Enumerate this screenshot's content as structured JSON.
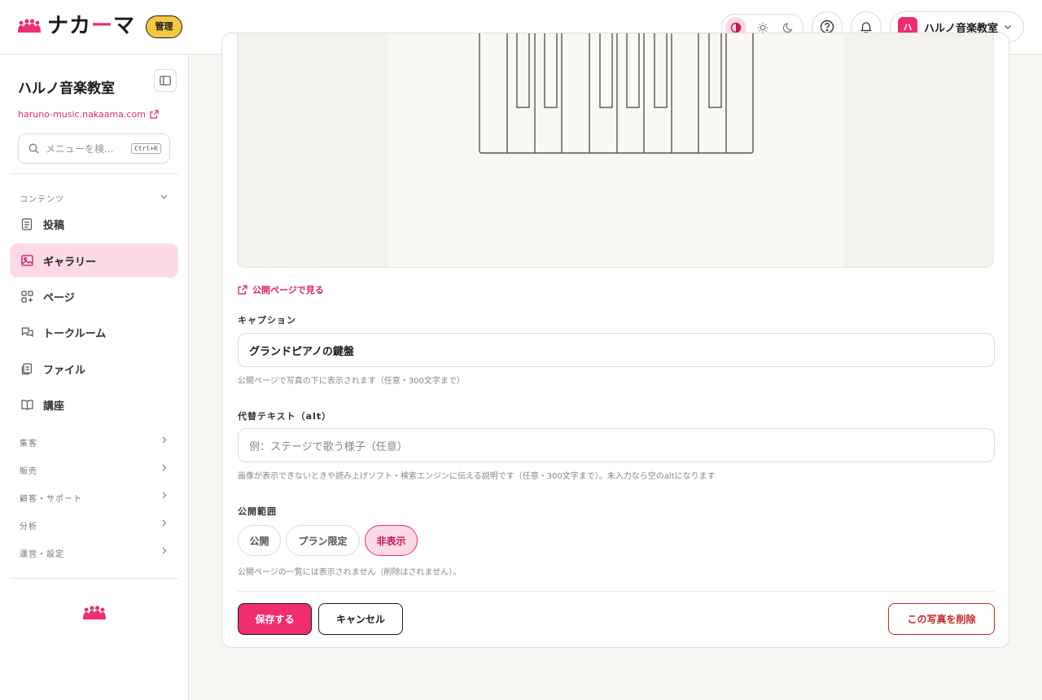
{
  "header": {
    "logo_text_1": "ナカ",
    "logo_text_accent": "ー",
    "logo_text_2": "マ",
    "admin_badge": "管理",
    "account_avatar": "ハ",
    "account_name": "ハルノ音楽教室"
  },
  "sidebar": {
    "site_name": "ハルノ音楽教室",
    "site_url": "haruno-music.nakaama.com",
    "search_placeholder": "メニューを検...",
    "search_shortcut": "Ctrl+K",
    "content_section": "コンテンツ",
    "items": [
      {
        "label": "投稿",
        "icon": "document-icon"
      },
      {
        "label": "ギャラリー",
        "icon": "image-icon",
        "active": true
      },
      {
        "label": "ページ",
        "icon": "grid-plus-icon"
      },
      {
        "label": "トークルーム",
        "icon": "chat-icon"
      },
      {
        "label": "ファイル",
        "icon": "files-icon"
      },
      {
        "label": "講座",
        "icon": "book-icon"
      }
    ],
    "sections": [
      "集客",
      "販売",
      "顧客・サポート",
      "分析",
      "運営・設定"
    ]
  },
  "main": {
    "view_public_link": "公開ページで見る",
    "caption_label": "キャプション",
    "caption_value": "グランドピアノの鍵盤",
    "caption_help": "公開ページで写真の下に表示されます（任意・300文字まで）",
    "alt_label": "代替テキスト（alt）",
    "alt_placeholder": "例：ステージで歌う様子（任意）",
    "alt_help": "画像が表示できないときや読み上げソフト・検索エンジンに伝える説明です（任意・300文字まで）。未入力なら空のaltになります",
    "visibility_label": "公開範囲",
    "visibility_options": [
      "公開",
      "プラン限定",
      "非表示"
    ],
    "visibility_selected": "非表示",
    "visibility_help": "公開ページの一覧には表示されません（削除はされません）。",
    "save_button": "保存する",
    "cancel_button": "キャンセル",
    "delete_button": "この写真を削除"
  },
  "colors": {
    "accent": "#ef2d6f",
    "accent_soft": "#fcd9e6",
    "badge_yellow": "#f5c842",
    "danger": "#c62828"
  }
}
